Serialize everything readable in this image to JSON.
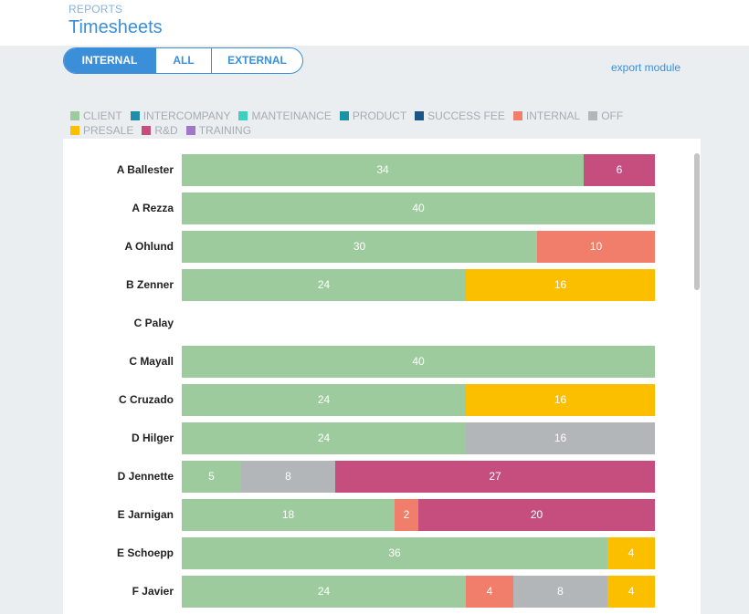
{
  "header": {
    "eyebrow": "REPORTS",
    "title": "Timesheets"
  },
  "tabs": [
    {
      "label": "INTERNAL",
      "active": true
    },
    {
      "label": "ALL",
      "active": false
    },
    {
      "label": "EXTERNAL",
      "active": false
    }
  ],
  "export_label": "export module",
  "legend": [
    {
      "label": "CLIENT",
      "color": "#9ecb9e"
    },
    {
      "label": "INTERCOMPANY",
      "color": "#1f8ea8"
    },
    {
      "label": "MANTEINANCE",
      "color": "#3dcfc0"
    },
    {
      "label": "PRODUCT",
      "color": "#1b93a6"
    },
    {
      "label": "SUCCESS FEE",
      "color": "#1a5587"
    },
    {
      "label": "INTERNAL",
      "color": "#f07e6a"
    },
    {
      "label": "OFF",
      "color": "#b2b6b8"
    },
    {
      "label": "PRESALE",
      "color": "#fbbf00"
    },
    {
      "label": "R&D",
      "color": "#c54e7e"
    },
    {
      "label": "TRAINING",
      "color": "#a178c8"
    }
  ],
  "chart_data": {
    "type": "bar",
    "orientation": "horizontal",
    "stacked": true,
    "xlim": [
      0,
      40
    ],
    "rows": [
      {
        "name": "A Ballester",
        "segments": [
          {
            "category": "CLIENT",
            "value": 34
          },
          {
            "category": "R&D",
            "value": 6
          }
        ]
      },
      {
        "name": "A Rezza",
        "segments": [
          {
            "category": "CLIENT",
            "value": 40
          }
        ]
      },
      {
        "name": "A Ohlund",
        "segments": [
          {
            "category": "CLIENT",
            "value": 30
          },
          {
            "category": "INTERNAL",
            "value": 10
          }
        ]
      },
      {
        "name": "B Zenner",
        "segments": [
          {
            "category": "CLIENT",
            "value": 24
          },
          {
            "category": "PRESALE",
            "value": 16
          }
        ]
      },
      {
        "name": "C Palay",
        "segments": []
      },
      {
        "name": "C Mayall",
        "segments": [
          {
            "category": "CLIENT",
            "value": 40
          }
        ]
      },
      {
        "name": "C Cruzado",
        "segments": [
          {
            "category": "CLIENT",
            "value": 24
          },
          {
            "category": "PRESALE",
            "value": 16
          }
        ]
      },
      {
        "name": "D Hilger",
        "segments": [
          {
            "category": "CLIENT",
            "value": 24
          },
          {
            "category": "OFF",
            "value": 16
          }
        ]
      },
      {
        "name": "D Jennette",
        "segments": [
          {
            "category": "CLIENT",
            "value": 5
          },
          {
            "category": "OFF",
            "value": 8
          },
          {
            "category": "R&D",
            "value": 27
          }
        ]
      },
      {
        "name": "E Jarnigan",
        "segments": [
          {
            "category": "CLIENT",
            "value": 18
          },
          {
            "category": "INTERNAL",
            "value": 2
          },
          {
            "category": "R&D",
            "value": 20
          }
        ]
      },
      {
        "name": "E Schoepp",
        "segments": [
          {
            "category": "CLIENT",
            "value": 36
          },
          {
            "category": "PRESALE",
            "value": 4
          }
        ]
      },
      {
        "name": "F Javier",
        "segments": [
          {
            "category": "CLIENT",
            "value": 24
          },
          {
            "category": "INTERNAL",
            "value": 4
          },
          {
            "category": "OFF",
            "value": 8
          },
          {
            "category": "PRESALE",
            "value": 4
          }
        ]
      }
    ]
  }
}
